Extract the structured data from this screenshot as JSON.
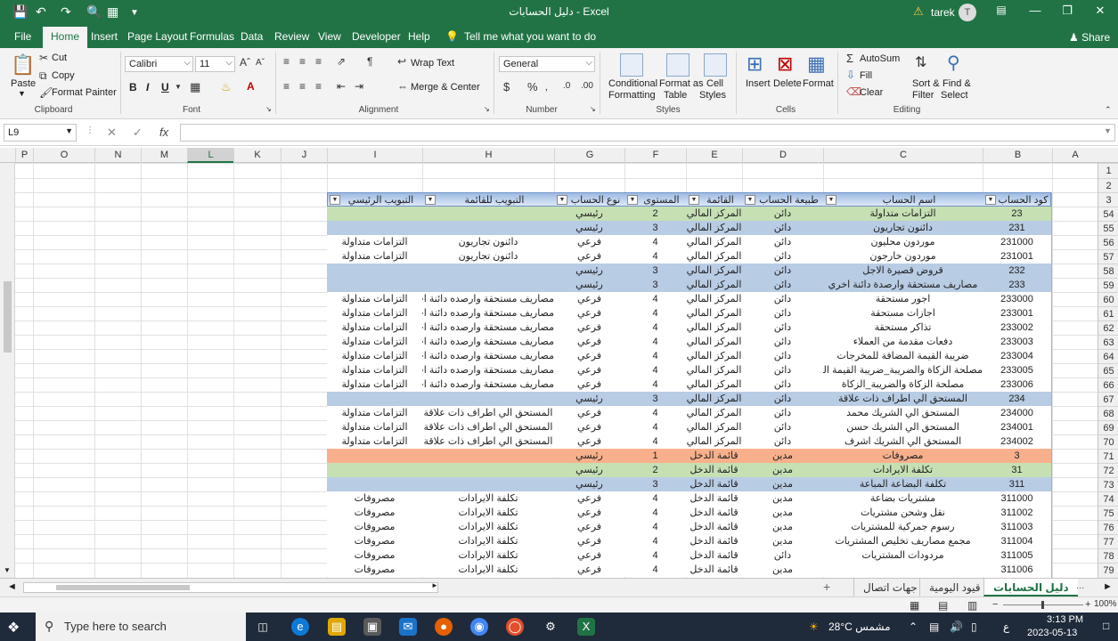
{
  "titlebar": {
    "title": "دليل الحسابات  -  Excel",
    "user": "tarek",
    "avatar_initial": "T",
    "ribbon_display_icon": "ribbon-display-icon",
    "min_glyph": "—",
    "max_glyph": "❐",
    "close_glyph": "✕"
  },
  "menu": {
    "tabs": [
      "File",
      "Home",
      "Insert",
      "Page Layout",
      "Formulas",
      "Data",
      "Review",
      "View",
      "Developer",
      "Help"
    ],
    "tell_me": "Tell me what you want to do",
    "share": "Share"
  },
  "ribbon": {
    "clipboard": {
      "paste": "Paste",
      "cut": "Cut",
      "copy": "Copy",
      "format_painter": "Format Painter",
      "label": "Clipboard"
    },
    "font": {
      "name": "Calibri",
      "size": "11",
      "label": "Font"
    },
    "alignment": {
      "wrap_text": "Wrap Text",
      "merge_center": "Merge & Center",
      "label": "Alignment"
    },
    "number": {
      "format": "General",
      "label": "Number"
    },
    "styles": {
      "conditional": [
        "Conditional",
        "Formatting"
      ],
      "format_table": [
        "Format as",
        "Table"
      ],
      "cell_styles": [
        "Cell",
        "Styles"
      ],
      "label": "Styles"
    },
    "cells": {
      "insert": "Insert",
      "delete": "Delete",
      "format": "Format",
      "label": "Cells"
    },
    "editing": {
      "autosum": "AutoSum",
      "fill": "Fill",
      "clear": "Clear",
      "sort": [
        "Sort &",
        "Filter"
      ],
      "find": [
        "Find &",
        "Select"
      ],
      "label": "Editing"
    }
  },
  "formula_bar": {
    "name_box": "L9",
    "content": ""
  },
  "grid": {
    "columns": [
      "P",
      "O",
      "N",
      "M",
      "L",
      "K",
      "J",
      "I",
      "H",
      "G",
      "F",
      "E",
      "D",
      "C",
      "B",
      "A"
    ],
    "selected_column": "L",
    "row_numbers": [
      "1",
      "2",
      "3",
      "54",
      "55",
      "56",
      "57",
      "58",
      "59",
      "60",
      "61",
      "62",
      "63",
      "64",
      "65",
      "66",
      "67",
      "68",
      "69",
      "70",
      "71",
      "72",
      "73",
      "74",
      "75",
      "76",
      "77",
      "78",
      "79"
    ]
  },
  "table": {
    "headers": [
      "كود الحساب",
      "اسم الحساب",
      "طبيعة الحساب",
      "القائمة",
      "المستوى",
      "نوع الحساب",
      "التبويب للقائمة",
      "التبويب الرئيسي"
    ],
    "rows": [
      {
        "style": "green",
        "cells": [
          "23",
          "التزامات متداولة",
          "دائن",
          "المركز المالي",
          "2",
          "رئيسي",
          "",
          ""
        ]
      },
      {
        "style": "blue",
        "cells": [
          "231",
          "دائنون تجاريون",
          "دائن",
          "المركز المالي",
          "3",
          "رئيسي",
          "",
          ""
        ]
      },
      {
        "style": "white",
        "cells": [
          "231000",
          "موردون محليون",
          "دائن",
          "المركز المالي",
          "4",
          "فرعي",
          "دائنون تجاريون",
          "التزامات متداولة"
        ]
      },
      {
        "style": "white",
        "cells": [
          "231001",
          "موردون خارجون",
          "دائن",
          "المركز المالي",
          "4",
          "فرعي",
          "دائنون تجاريون",
          "التزامات متداولة"
        ]
      },
      {
        "style": "blue",
        "cells": [
          "232",
          "قروض قصيرة الاجل",
          "دائن",
          "المركز المالي",
          "3",
          "رئيسي",
          "",
          ""
        ]
      },
      {
        "style": "blue",
        "cells": [
          "233",
          "مصاريف مستحقة وارصدة دائنة اخري",
          "دائن",
          "المركز المالي",
          "3",
          "رئيسي",
          "",
          ""
        ]
      },
      {
        "style": "white",
        "cells": [
          "233000",
          "اجور مستحقة",
          "دائن",
          "المركز المالي",
          "4",
          "فرعي",
          "مصاريف مستحقة وارصده دائنة اخري",
          "التزامات متداولة"
        ]
      },
      {
        "style": "white",
        "cells": [
          "233001",
          "اجازات مستحقة",
          "دائن",
          "المركز المالي",
          "4",
          "فرعي",
          "مصاريف مستحقة وارصده دائنة اخري",
          "التزامات متداولة"
        ]
      },
      {
        "style": "white",
        "cells": [
          "233002",
          "تذاكر مستحقة",
          "دائن",
          "المركز المالي",
          "4",
          "فرعي",
          "مصاريف مستحقة وارصده دائنة اخري",
          "التزامات متداولة"
        ]
      },
      {
        "style": "white",
        "cells": [
          "233003",
          "دفعات مقدمة من العملاء",
          "دائن",
          "المركز المالي",
          "4",
          "فرعي",
          "مصاريف مستحقة وارصده دائنة اخري",
          "التزامات متداولة"
        ]
      },
      {
        "style": "white",
        "cells": [
          "233004",
          "ضريبة القيمة المضافة للمخرجات",
          "دائن",
          "المركز المالي",
          "4",
          "فرعي",
          "مصاريف مستحقة وارصده دائنة اخري",
          "التزامات متداولة"
        ]
      },
      {
        "style": "white",
        "cells": [
          "233005",
          "مصلحة الزكاة والضريبة_ضريبة القيمة المضافة",
          "دائن",
          "المركز المالي",
          "4",
          "فرعي",
          "مصاريف مستحقة وارصده دائنة اخري",
          "التزامات متداولة"
        ]
      },
      {
        "style": "white",
        "cells": [
          "233006",
          "مصلحة الزكاة والضريبة_الزكاة",
          "دائن",
          "المركز المالي",
          "4",
          "فرعي",
          "مصاريف مستحقة وارصده دائنة اخري",
          "التزامات متداولة"
        ]
      },
      {
        "style": "blue",
        "cells": [
          "234",
          "المستحق الي اطراف ذات علاقة",
          "دائن",
          "المركز المالي",
          "3",
          "رئيسي",
          "",
          ""
        ]
      },
      {
        "style": "white",
        "cells": [
          "234000",
          "المستحق الي الشريك محمد",
          "دائن",
          "المركز المالي",
          "4",
          "فرعي",
          "المستحق الي اطراف ذات علاقة",
          "التزامات متداولة"
        ]
      },
      {
        "style": "white",
        "cells": [
          "234001",
          "المستحق الي الشريك حسن",
          "دائن",
          "المركز المالي",
          "4",
          "فرعي",
          "المستحق الي اطراف ذات علاقة",
          "التزامات متداولة"
        ]
      },
      {
        "style": "white",
        "cells": [
          "234002",
          "المستحق الي الشريك اشرف",
          "دائن",
          "المركز المالي",
          "4",
          "فرعي",
          "المستحق الي اطراف ذات علاقة",
          "التزامات متداولة"
        ]
      },
      {
        "style": "orange",
        "cells": [
          "3",
          "مصروفات",
          "مدين",
          "قائمة الدخل",
          "1",
          "رئيسي",
          "",
          ""
        ]
      },
      {
        "style": "green",
        "cells": [
          "31",
          "تكلفة الايرادات",
          "مدين",
          "قائمة الدخل",
          "2",
          "رئيسي",
          "",
          ""
        ]
      },
      {
        "style": "blue",
        "cells": [
          "311",
          "تكلفة البضاعة المباعة",
          "مدين",
          "قائمة الدخل",
          "3",
          "رئيسي",
          "",
          ""
        ]
      },
      {
        "style": "white",
        "cells": [
          "311000",
          "مشتريات بضاعة",
          "مدين",
          "قائمة الدخل",
          "4",
          "فرعي",
          "تكلفة الايرادات",
          "مصروفات"
        ]
      },
      {
        "style": "white",
        "cells": [
          "311002",
          "نقل وشحن مشتريات",
          "مدين",
          "قائمة الدخل",
          "4",
          "فرعي",
          "تكلفة الايرادات",
          "مصروفات"
        ]
      },
      {
        "style": "white",
        "cells": [
          "311003",
          "رسوم جمركية للمشتريات",
          "مدين",
          "قائمة الدخل",
          "4",
          "فرعي",
          "تكلفة الايرادات",
          "مصروفات"
        ]
      },
      {
        "style": "white",
        "cells": [
          "311004",
          "مجمع مصاريف تخليص المشتريات",
          "مدين",
          "قائمة الدخل",
          "4",
          "فرعي",
          "تكلفة الايرادات",
          "مصروفات"
        ]
      },
      {
        "style": "white",
        "cells": [
          "311005",
          "مردودات المشتريات",
          "دائن",
          "قائمة الدخل",
          "4",
          "فرعي",
          "تكلفة الايرادات",
          "مصروفات"
        ]
      },
      {
        "style": "white",
        "cells": [
          "311006",
          "",
          "مدين",
          "قائمة الدخل",
          "4",
          "فرعي",
          "تكلفة الايرادات",
          "مصروفات"
        ]
      }
    ]
  },
  "sheet_tabs": {
    "tabs": [
      "دليل الحسابات",
      "قيود اليومية",
      "جهات اتصال"
    ],
    "active": "دليل الحسابات",
    "add": "+",
    "ellipsis": "..."
  },
  "status": {
    "zoom": "100%",
    "zoom_minus": "−",
    "zoom_plus": "+"
  },
  "taskbar": {
    "search_placeholder": "Type here to search",
    "weather": "28°C  مشمس",
    "lang": "ع",
    "time": "3:13 PM",
    "date": "2023-05-13"
  }
}
